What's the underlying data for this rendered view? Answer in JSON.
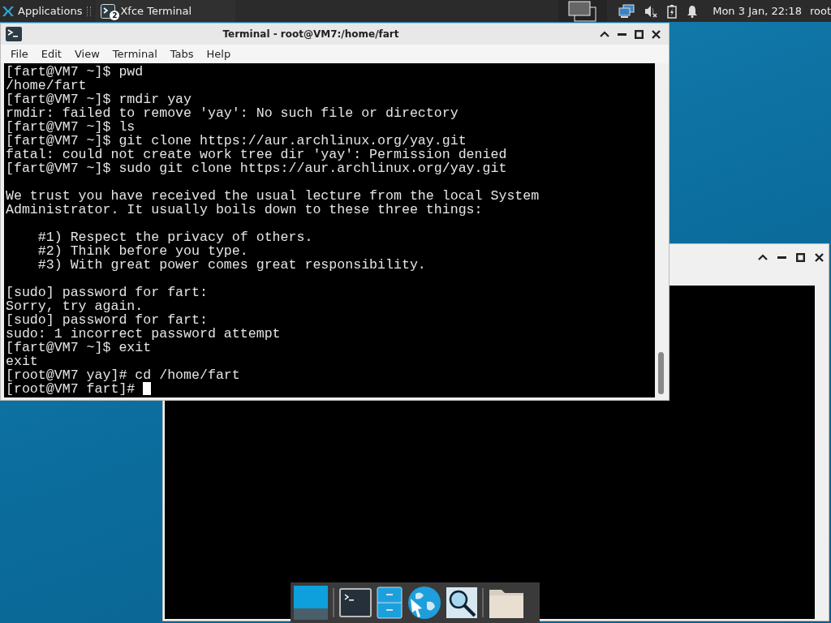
{
  "panel": {
    "applications": "Applications",
    "taskbar_button": {
      "label": "Xfce Terminal",
      "count": "2"
    },
    "clock": "Mon 3 Jan, 22:18",
    "user": "root"
  },
  "terminal_window": {
    "title": "Terminal - root@VM7:/home/fart",
    "menu": [
      "File",
      "Edit",
      "View",
      "Terminal",
      "Tabs",
      "Help"
    ],
    "paragraphs": [
      [
        "[fart@VM7 ~]$ pwd",
        "/home/fart",
        "[fart@VM7 ~]$ rmdir yay",
        "rmdir: failed to remove 'yay': No such file or directory",
        "[fart@VM7 ~]$ ls",
        "[fart@VM7 ~]$ git clone https://aur.archlinux.org/yay.git",
        "fatal: could not create work tree dir 'yay': Permission denied",
        "[fart@VM7 ~]$ sudo git clone https://aur.archlinux.org/yay.git"
      ],
      [
        "We trust you have received the usual lecture from the local System",
        "Administrator. It usually boils down to these three things:"
      ],
      [
        "    #1) Respect the privacy of others.",
        "    #2) Think before you type.",
        "    #3) With great power comes great responsibility."
      ],
      [
        "[sudo] password for fart:",
        "Sorry, try again.",
        "[sudo] password for fart:",
        "sudo: 1 incorrect password attempt",
        "[fart@VM7 ~]$ exit",
        "exit",
        "[root@VM7 yay]# cd /home/fart",
        "[root@VM7 fart]# "
      ]
    ]
  }
}
